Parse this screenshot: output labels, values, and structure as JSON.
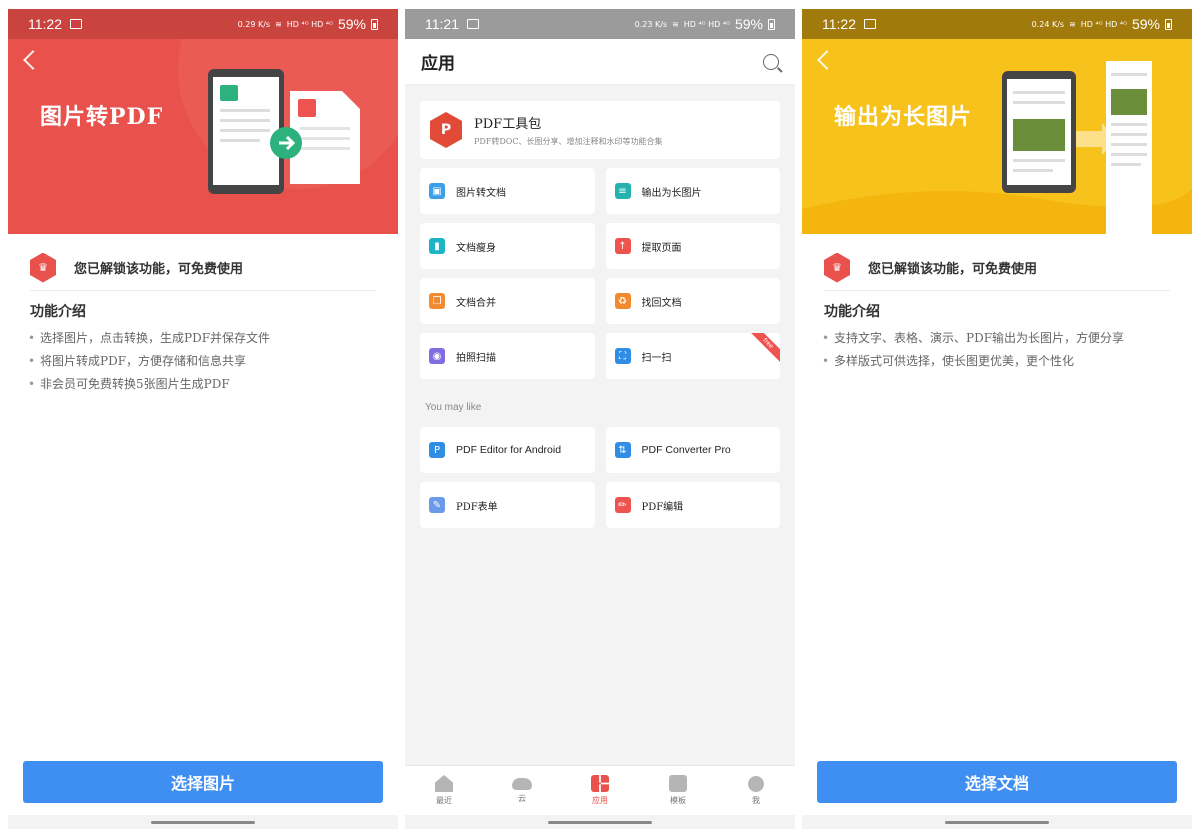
{
  "status_left": {
    "time": "11:22",
    "speed": "0.29 K/s"
  },
  "status_mid": {
    "time": "11:21",
    "speed": "0.23 K/s"
  },
  "status_right": {
    "time": "11:22",
    "speed": "0.24 K/s"
  },
  "status_common": {
    "signal": "HD ⁴ᴳ HD ⁴ᴳ",
    "battery": "59%"
  },
  "left_panel": {
    "title": "图片转PDF",
    "unlock_text": "您已解锁该功能，可免费使用",
    "intro_title": "功能介绍",
    "intro_items": [
      "选择图片，点击转换，生成PDF并保存文件",
      "将图片转成PDF，方便存储和信息共享",
      "非会员可免费转换5张图片生成PDF"
    ],
    "cta": "选择图片",
    "accent": "#e8514c"
  },
  "middle_panel": {
    "header_title": "应用",
    "toolkit": {
      "title": "PDF工具包",
      "subtitle": "PDF转DOC、长图分享、增加注释和水印等功能合集"
    },
    "tools": [
      {
        "label": "图片转文档",
        "icon": "image-to-doc-icon",
        "color": "#3aa0e8"
      },
      {
        "label": "输出为长图片",
        "icon": "long-image-icon",
        "color": "#26b3b0"
      },
      {
        "label": "文档瘦身",
        "icon": "slim-doc-icon",
        "color": "#1bb5c4"
      },
      {
        "label": "提取页面",
        "icon": "extract-page-icon",
        "color": "#ef5350"
      },
      {
        "label": "文档合并",
        "icon": "merge-doc-icon",
        "color": "#f28b30"
      },
      {
        "label": "找回文档",
        "icon": "recover-doc-icon",
        "color": "#f28b30"
      },
      {
        "label": "拍照扫描",
        "icon": "camera-scan-icon",
        "color": "#7e6ee0"
      },
      {
        "label": "扫一扫",
        "icon": "qr-scan-icon",
        "color": "#2f8de4",
        "badge": "free"
      }
    ],
    "may_like_label": "You may like",
    "may_like": [
      {
        "label": "PDF Editor for Android",
        "icon": "pdf-editor-icon",
        "color": "#2f8de4"
      },
      {
        "label": "PDF Converter Pro",
        "icon": "pdf-converter-icon",
        "color": "#2f8de4"
      },
      {
        "label": "PDF表单",
        "icon": "pdf-form-icon",
        "color": "#6a9ae8"
      },
      {
        "label": "PDF编辑",
        "icon": "pdf-edit-icon",
        "color": "#ef5350"
      }
    ],
    "tabs": [
      {
        "label": "最近",
        "icon": "home"
      },
      {
        "label": "云",
        "icon": "cloud"
      },
      {
        "label": "应用",
        "icon": "grid4",
        "active": true
      },
      {
        "label": "模板",
        "icon": "template"
      },
      {
        "label": "我",
        "icon": "user"
      }
    ]
  },
  "right_panel": {
    "title": "输出为长图片",
    "unlock_text": "您已解锁该功能，可免费使用",
    "intro_title": "功能介绍",
    "intro_items": [
      "支持文字、表格、演示、PDF输出为长图片，方便分享",
      "多样版式可供选择，使长图更优美，更个性化"
    ],
    "cta": "选择文档",
    "accent": "#f7c21c"
  }
}
